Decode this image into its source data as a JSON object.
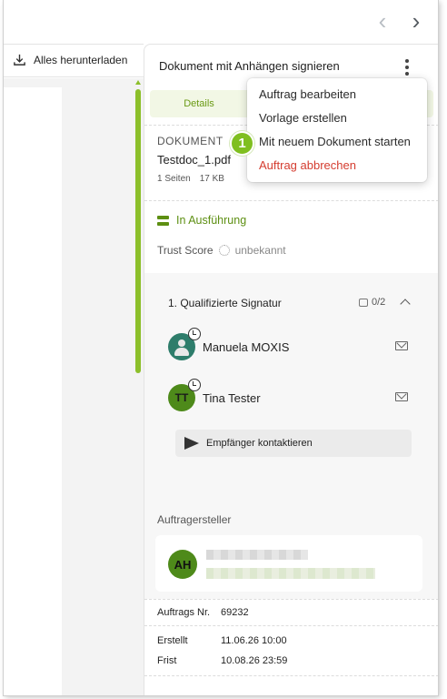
{
  "nav": {
    "prev": "‹",
    "next": "›"
  },
  "toolbar": {
    "download_label": "Alles herunterladen"
  },
  "panel": {
    "title": "Dokument mit Anhängen signieren",
    "tab_details": "Details"
  },
  "document": {
    "heading": "DOKUMENT",
    "filename": "Testdoc_1.pdf",
    "pages": "1 Seiten",
    "size": "17 KB"
  },
  "status": {
    "label": "In Ausführung",
    "trust_label": "Trust Score",
    "trust_value": "unbekannt"
  },
  "signature": {
    "heading": "1. Qualifizierte Signatur",
    "count": "0/2",
    "signers": [
      {
        "name": "Manuela MOXIS",
        "initials": ""
      },
      {
        "name": "Tina Tester",
        "initials": "TT"
      }
    ],
    "contact_label": "Empfänger kontaktieren"
  },
  "creator": {
    "heading": "Auftragersteller",
    "initials": "AH"
  },
  "order": {
    "number_label": "Auftrags Nr.",
    "number_value": "69232",
    "created_label": "Erstellt",
    "created_value": "11.06.26 10:00",
    "deadline_label": "Frist",
    "deadline_value": "10.08.26 23:59"
  },
  "menu": {
    "items": [
      "Auftrag bearbeiten",
      "Vorlage erstellen",
      "Mit neuem Dokument starten",
      "Auftrag abbrechen"
    ]
  },
  "step_badge": "1",
  "colors": {
    "accent": "#7fbf1f",
    "status_green": "#5d8f12",
    "danger": "#d43c2f"
  }
}
